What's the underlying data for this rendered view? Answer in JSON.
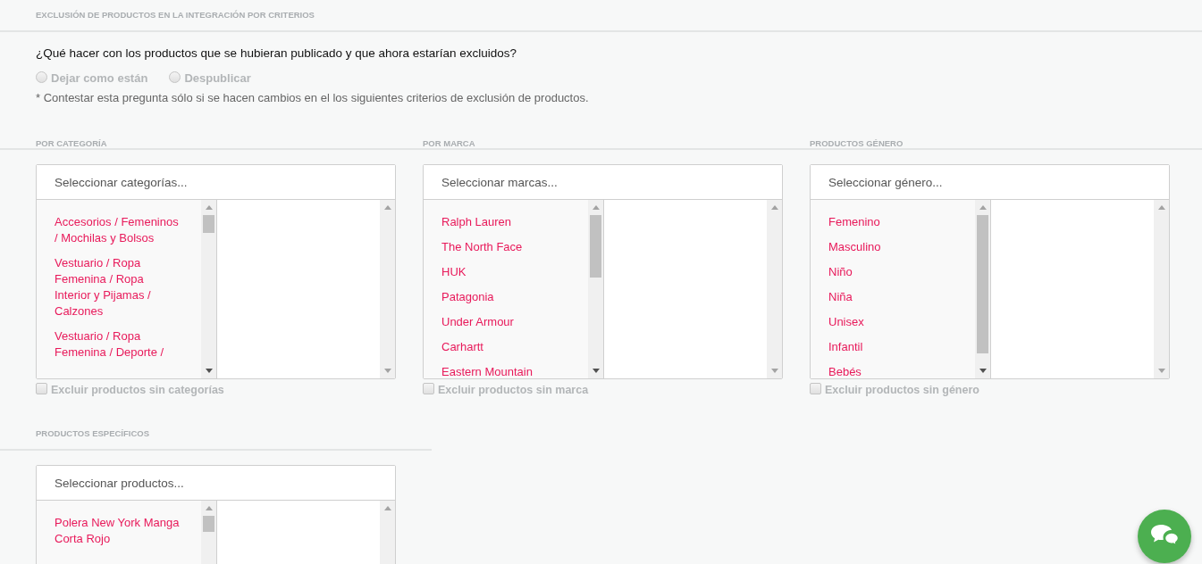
{
  "header": {
    "title": "EXCLUSIÓN DE PRODUCTOS EN LA INTEGRACIÓN POR CRITERIOS"
  },
  "question": {
    "text": "¿Qué hacer con los productos que se hubieran publicado y que ahora estarían excluidos?",
    "options": [
      {
        "label": "Dejar como están",
        "selected": false,
        "disabled": true
      },
      {
        "label": "Despublicar",
        "selected": false,
        "disabled": true
      }
    ],
    "note": "* Contestar esta pregunta sólo si se hacen cambios en el los siguientes criterios de exclusión de productos."
  },
  "filters": [
    {
      "heading": "POR CATEGORÍA",
      "placeholder": "Seleccionar categorías...",
      "options": [
        "Accesorios / Femeninos / Mochilas y Bolsos",
        "Vestuario / Ropa Femenina / Ropa Interior y Pijamas / Calzones",
        "Vestuario / Ropa Femenina / Deporte /"
      ],
      "exclude": {
        "label": "Excluir productos sin categorías",
        "checked": false,
        "disabled": true
      }
    },
    {
      "heading": "POR MARCA",
      "placeholder": "Seleccionar marcas...",
      "options": [
        "Ralph Lauren",
        "The North Face",
        "HUK",
        "Patagonia",
        "Under Armour",
        "Carhartt",
        "Eastern Mountain"
      ],
      "exclude": {
        "label": "Excluir productos sin marca",
        "checked": false,
        "disabled": true
      }
    },
    {
      "heading": "PRODUCTOS GÉNERO",
      "placeholder": "Seleccionar género...",
      "options": [
        "Femenino",
        "Masculino",
        "Niño",
        "Niña",
        "Unisex",
        "Infantil",
        "Bebés"
      ],
      "exclude": {
        "label": "Excluir productos sin género",
        "checked": false,
        "disabled": true
      }
    }
  ],
  "specific": {
    "heading": "PRODUCTOS ESPECÍFICOS",
    "placeholder": "Seleccionar productos...",
    "options": [
      "Polera New York Manga Corta Rojo"
    ]
  }
}
